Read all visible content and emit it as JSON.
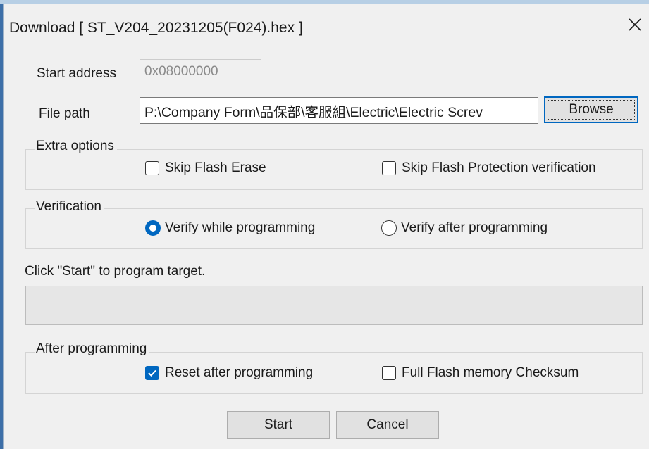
{
  "window": {
    "title": "Download [ ST_V204_20231205(F024).hex ]"
  },
  "start_address": {
    "label": "Start address",
    "value": "0x08000000"
  },
  "file_path": {
    "label": "File path",
    "value": "P:\\Company Form\\品保部\\客服組\\Electric\\Electric Screv",
    "browse_label": "Browse"
  },
  "extra_options": {
    "title": "Extra options",
    "skip_flash_erase": {
      "label": "Skip Flash Erase",
      "checked": false
    },
    "skip_flash_protection": {
      "label": "Skip Flash Protection verification",
      "checked": false
    }
  },
  "verification": {
    "title": "Verification",
    "verify_while": {
      "label": "Verify while programming",
      "selected": true
    },
    "verify_after": {
      "label": "Verify after programming",
      "selected": false
    }
  },
  "status_text": "Click \"Start\" to program target.",
  "progress": 0,
  "after_programming": {
    "title": "After programming",
    "reset_after": {
      "label": "Reset after programming",
      "checked": true
    },
    "full_checksum": {
      "label": "Full Flash memory Checksum",
      "checked": false
    }
  },
  "buttons": {
    "start": "Start",
    "cancel": "Cancel"
  },
  "colors": {
    "accent": "#0067c0",
    "dialog_bg": "#f0f0f0",
    "progress_fill": "#06b025"
  },
  "icons": {
    "close": "close-icon",
    "check": "checkmark-icon"
  }
}
